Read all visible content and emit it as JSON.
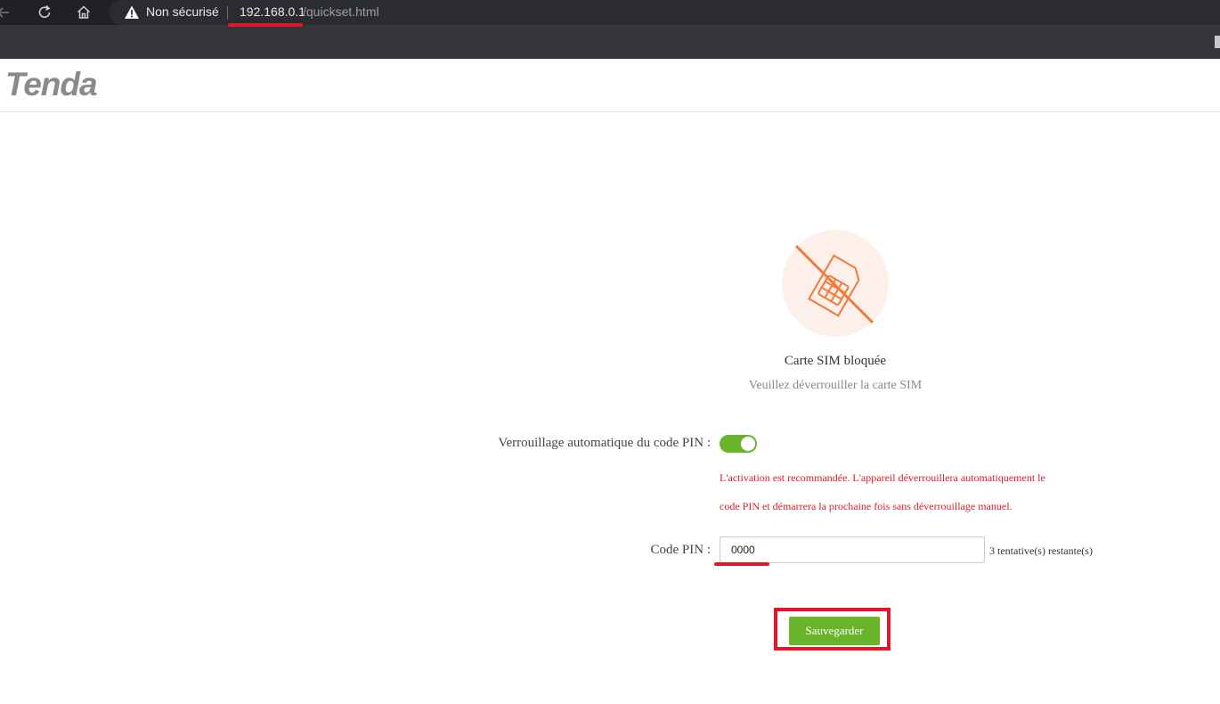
{
  "browser": {
    "security_label": "Non sécurisé",
    "url_host": "192.168.0.1",
    "url_path": "/quickset.html"
  },
  "header": {
    "logo_text": "Tenda"
  },
  "sim": {
    "title": "Carte SIM bloquée",
    "subtitle": "Veuillez déverrouiller la carte SIM"
  },
  "form": {
    "auto_pin_label": "Verrouillage automatique du code PIN :",
    "auto_pin_enabled": true,
    "hint_line1": "L'activation est recommandée. L'appareil déverrouillera automatiquement le",
    "hint_line2": "code PIN et démarrera la prochaine fois sans déverrouillage manuel.",
    "pin_label": "Code PIN :",
    "pin_value": "0000",
    "attempts_text": "3 tentative(s) restante(s)",
    "save_label": "Sauvegarder"
  },
  "colors": {
    "accent_green": "#6ab42c",
    "warning_red": "#d9202b",
    "highlight_red": "#e0162b",
    "sim_orange": "#f07a3a"
  },
  "icons": [
    "back-arrow-icon",
    "reload-icon",
    "home-icon",
    "warning-icon",
    "sim-locked-icon"
  ]
}
